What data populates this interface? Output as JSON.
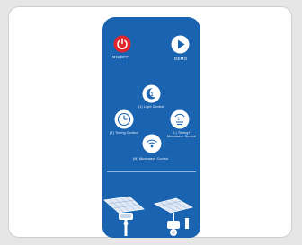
{
  "remote": {
    "power_label": "ON/OFF",
    "demo_label": "DEMO",
    "light_control_label": "(1)  Light Control",
    "timing_control_label": "(T)  Timing Control",
    "timing_plus_label": "(L)  Timing+",
    "microwave_control_right_label": "Microwave Control",
    "microwave_control_label": "(M)  Microwave Control"
  },
  "colors": {
    "remote_body": "#1a63b0",
    "power_button": "#e2252b",
    "icon_white": "#ffffff"
  }
}
